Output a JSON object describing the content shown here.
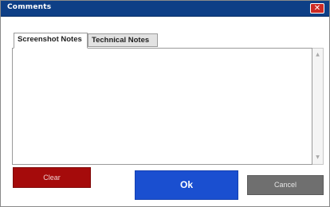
{
  "window": {
    "title": "Comments",
    "close_glyph": "✕"
  },
  "tabs": [
    {
      "label": "Screenshot Notes",
      "active": true
    },
    {
      "label": "Technical Notes",
      "active": false
    }
  ],
  "notes": {
    "value": ""
  },
  "scrollbar": {
    "up_glyph": "▲",
    "down_glyph": "▼"
  },
  "buttons": {
    "clear_label": "Clear",
    "ok_label": "Ok",
    "cancel_label": "Cancel"
  },
  "colors": {
    "titlebar": "#0e3f86",
    "close": "#cc2a24",
    "clear": "#a50b0b",
    "ok": "#1a4fd0",
    "cancel": "#6f6f6f"
  }
}
